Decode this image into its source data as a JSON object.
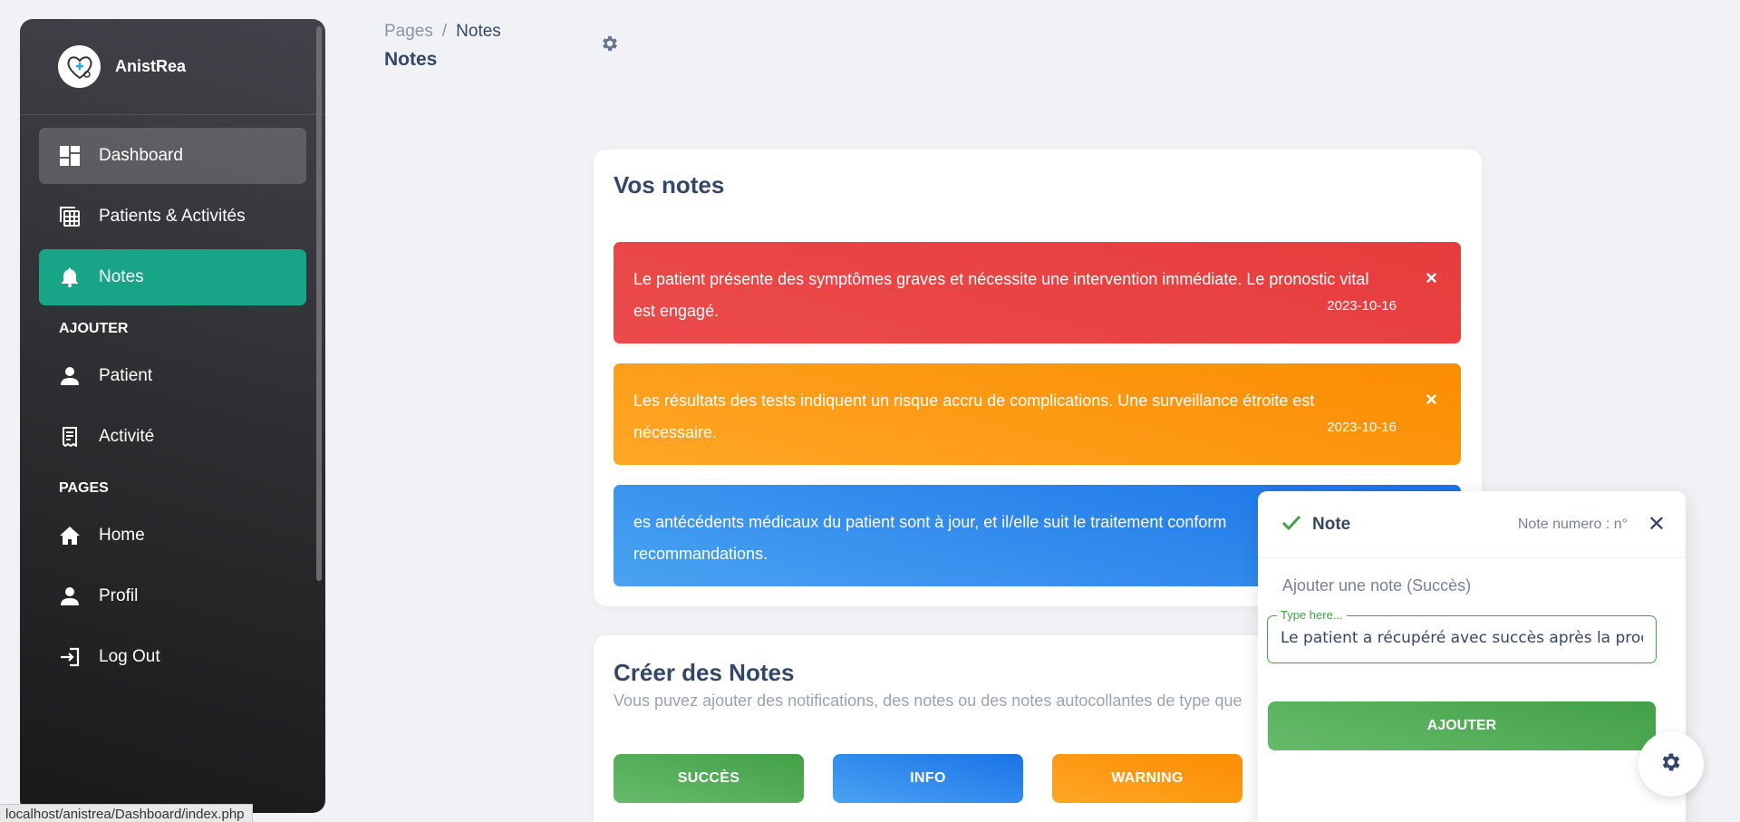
{
  "brand": {
    "name": "AnistRea"
  },
  "sidebar": {
    "items": [
      {
        "label": "Dashboard",
        "icon": "dashboard-icon"
      },
      {
        "label": "Patients & Activités",
        "icon": "table-icon"
      },
      {
        "label": "Notes",
        "icon": "bell-icon"
      }
    ],
    "section_add": "AJOUTER",
    "add_items": [
      {
        "label": "Patient",
        "icon": "person-icon"
      },
      {
        "label": "Activité",
        "icon": "receipt-icon"
      }
    ],
    "section_pages": "PAGES",
    "page_items": [
      {
        "label": "Home",
        "icon": "home-icon"
      },
      {
        "label": "Profil",
        "icon": "person-icon"
      },
      {
        "label": "Log Out",
        "icon": "login-icon"
      }
    ]
  },
  "header": {
    "breadcrumb_root": "Pages",
    "breadcrumb_sep": "/",
    "breadcrumb_current": "Notes",
    "title": "Notes"
  },
  "notes_card": {
    "title": "Vos notes",
    "alerts": [
      {
        "type": "danger",
        "text": "Le patient présente des symptômes graves et nécessite une intervention immédiate. Le pronostic vital est engagé.",
        "date": "2023-10-16",
        "close": "×"
      },
      {
        "type": "warning",
        "text": "Les résultats des tests indiquent un risque accru de complications. Une surveillance étroite est nécessaire.",
        "date": "2023-10-16",
        "close": "×"
      },
      {
        "type": "info",
        "text": "es antécédents médicaux du patient sont à jour, et il/elle suit le traitement conform",
        "text2": "recommandations."
      }
    ]
  },
  "create_card": {
    "title": "Créer des Notes",
    "subtitle": "Vous puvez ajouter des notifications, des notes ou des notes autocollantes de type que",
    "buttons": {
      "success": "SUCCÈS",
      "info": "INFO",
      "warning": "WARNING"
    }
  },
  "panel": {
    "title": "Note",
    "number_label": "Note numero : n°",
    "close": "✕",
    "add_label": "Ajouter une note (Succès)",
    "input_legend": "Type here...",
    "input_value": "Le patient a récupéré avec succès après la procédure",
    "add_button": "AJOUTER"
  },
  "statusbar": {
    "url": "localhost/anistrea/Dashboard/index.php"
  },
  "colors": {
    "active": "#17a487",
    "danger": "#e63c3c",
    "warning": "#fb8c00",
    "info": "#1a73e8",
    "success": "#43a047"
  }
}
